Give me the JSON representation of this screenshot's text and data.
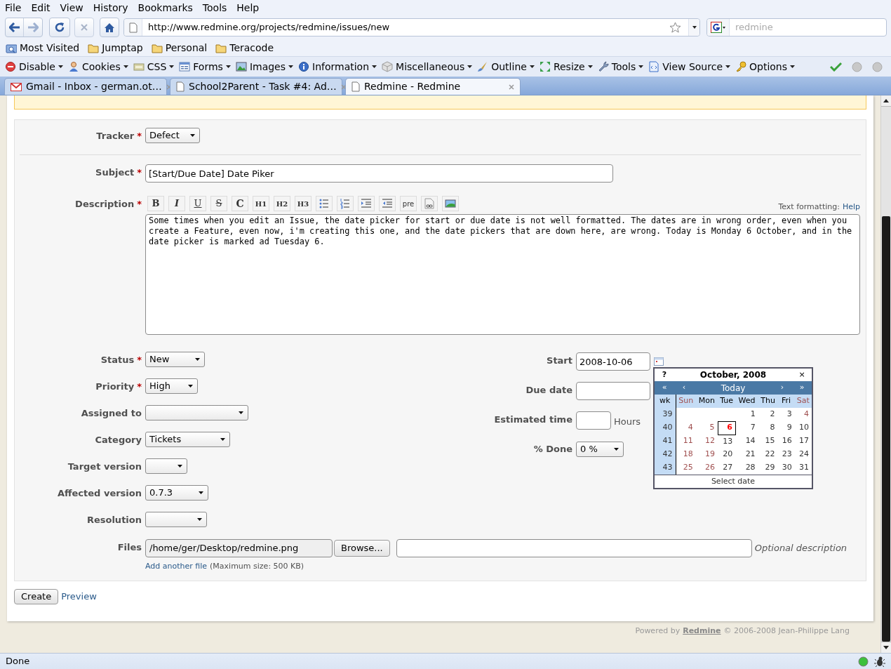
{
  "menu_bar": [
    {
      "label": "File"
    },
    {
      "label": "Edit"
    },
    {
      "label": "View"
    },
    {
      "label": "History"
    },
    {
      "label": "Bookmarks"
    },
    {
      "label": "Tools"
    },
    {
      "label": "Help"
    }
  ],
  "address_bar": {
    "url": "http://www.redmine.org/projects/redmine/issues/new"
  },
  "search_bar": {
    "placeholder": "redmine"
  },
  "bookmarks": [
    {
      "label": "Most Visited",
      "kind": "smart"
    },
    {
      "label": "Jumptap",
      "kind": "folder"
    },
    {
      "label": "Personal",
      "kind": "folder"
    },
    {
      "label": "Teracode",
      "kind": "folder"
    }
  ],
  "developer_toolbar": [
    {
      "label": "Disable"
    },
    {
      "label": "Cookies"
    },
    {
      "label": "CSS"
    },
    {
      "label": "Forms"
    },
    {
      "label": "Images"
    },
    {
      "label": "Information"
    },
    {
      "label": "Miscellaneous"
    },
    {
      "label": "Outline"
    },
    {
      "label": "Resize"
    },
    {
      "label": "Tools"
    },
    {
      "label": "View Source"
    },
    {
      "label": "Options"
    }
  ],
  "tabs": [
    {
      "title": "Gmail - Inbox - german.ot…",
      "kind": "mail",
      "selected": false
    },
    {
      "title": "School2Parent - Task #4: Ad…",
      "kind": "page",
      "selected": false
    },
    {
      "title": "Redmine - Redmine",
      "kind": "page",
      "selected": true
    }
  ],
  "issue_form": {
    "tracker": {
      "label": "Tracker",
      "required_mark": "*",
      "value": "Defect"
    },
    "subject": {
      "label": "Subject",
      "required_mark": "*",
      "value": "[Start/Due Date] Date Piker"
    },
    "description": {
      "label": "Description",
      "required_mark": "*",
      "toolbar": [
        {
          "kind": "bold",
          "label": "B"
        },
        {
          "kind": "italic",
          "label": "I"
        },
        {
          "kind": "underline",
          "label": "U"
        },
        {
          "kind": "strike",
          "label": "S"
        },
        {
          "kind": "code",
          "label": "C"
        },
        {
          "kind": "heading",
          "label": "H1"
        },
        {
          "kind": "heading",
          "label": "H2"
        },
        {
          "kind": "heading",
          "label": "H3"
        },
        {
          "kind": "ul"
        },
        {
          "kind": "ol"
        },
        {
          "kind": "indent"
        },
        {
          "kind": "outdent"
        },
        {
          "kind": "pre",
          "label": "pre"
        },
        {
          "kind": "link"
        },
        {
          "kind": "image"
        }
      ],
      "text_formatting": {
        "label": "Text formatting:",
        "link": "Help"
      },
      "value": "Some times when you edit an Issue, the date picker for start or due date is not well formatted. The dates are in wrong order, even when you create a Feature, even now, i'm creating this one, and the date pickers that are down here, are wrong. Today is Monday 6 October, and in the date picker is marked ad Tuesday 6."
    },
    "attributes_left": [
      {
        "label": "Status",
        "required_mark": "*",
        "value": "New"
      },
      {
        "label": "Priority",
        "required_mark": "*",
        "value": "High"
      },
      {
        "label": "Assigned to"
      },
      {
        "label": "Category",
        "value": "Tickets"
      },
      {
        "label": "Target version"
      },
      {
        "label": "Affected version",
        "value": "0.7.3"
      },
      {
        "label": "Resolution"
      }
    ],
    "attributes_right": [
      {
        "label": "Start",
        "kind": "date",
        "value": "2008-10-06"
      },
      {
        "label": "Due date",
        "kind": "text"
      },
      {
        "label": "Estimated time",
        "kind": "text",
        "unit": "Hours"
      },
      {
        "label": "% Done",
        "kind": "select",
        "value": "0 %"
      }
    ],
    "files": {
      "label": "Files",
      "path": "/home/ger/Desktop/redmine.png",
      "browse": "Browse...",
      "description_hint": "Optional description",
      "add_link": "Add another file",
      "max_size": "(Maximum size: 500 KB)"
    },
    "create": "Create",
    "preview": "Preview"
  },
  "calendar": {
    "help": "?",
    "title": "October, 2008",
    "close": "×",
    "nav": [
      "«",
      "‹",
      "Today",
      "›",
      "»"
    ],
    "week_header": "wk",
    "day_names": [
      {
        "label": "Sun",
        "weekend": true
      },
      {
        "label": "Mon",
        "weekend": false
      },
      {
        "label": "Tue",
        "weekend": false
      },
      {
        "label": "Wed",
        "weekend": false
      },
      {
        "label": "Thu",
        "weekend": false
      },
      {
        "label": "Fri",
        "weekend": false
      },
      {
        "label": "Sat",
        "weekend": true
      }
    ],
    "weeks": [
      {
        "week": "39",
        "days": [
          {
            "label": "1",
            "weekend": false,
            "selected": false
          },
          {
            "label": "2",
            "weekend": false,
            "selected": false
          },
          {
            "label": "3",
            "weekend": false,
            "selected": false
          },
          {
            "label": "4",
            "weekend": true,
            "selected": false
          }
        ]
      },
      {
        "week": "40",
        "days": [
          {
            "label": "4",
            "weekend": true,
            "selected": false
          },
          {
            "label": "5",
            "weekend": true,
            "selected": false
          },
          {
            "label": "6",
            "selected": true
          },
          {
            "label": "7",
            "weekend": false,
            "selected": false
          },
          {
            "label": "8",
            "weekend": false,
            "selected": false
          },
          {
            "label": "9",
            "weekend": false,
            "selected": false
          },
          {
            "label": "10",
            "weekend": false,
            "selected": false
          }
        ]
      },
      {
        "week": "41",
        "days": [
          {
            "label": "11",
            "weekend": true,
            "selected": false
          },
          {
            "label": "12",
            "weekend": true,
            "selected": false
          },
          {
            "label": "13",
            "weekend": false,
            "selected": false
          },
          {
            "label": "14",
            "weekend": false,
            "selected": false
          },
          {
            "label": "15",
            "weekend": false,
            "selected": false
          },
          {
            "label": "16",
            "weekend": false,
            "selected": false
          },
          {
            "label": "17",
            "weekend": false,
            "selected": false
          }
        ]
      },
      {
        "week": "42",
        "days": [
          {
            "label": "18",
            "weekend": true,
            "selected": false
          },
          {
            "label": "19",
            "weekend": true,
            "selected": false
          },
          {
            "label": "20",
            "weekend": false,
            "selected": false
          },
          {
            "label": "21",
            "weekend": false,
            "selected": false
          },
          {
            "label": "22",
            "weekend": false,
            "selected": false
          },
          {
            "label": "23",
            "weekend": false,
            "selected": false
          },
          {
            "label": "24",
            "weekend": false,
            "selected": false
          }
        ]
      },
      {
        "week": "43",
        "days": [
          {
            "label": "25",
            "weekend": true,
            "selected": false
          },
          {
            "label": "26",
            "weekend": true,
            "selected": false
          },
          {
            "label": "27",
            "weekend": false,
            "selected": false
          },
          {
            "label": "28",
            "weekend": false,
            "selected": false
          },
          {
            "label": "29",
            "weekend": false,
            "selected": false
          },
          {
            "label": "30",
            "weekend": false,
            "selected": false
          },
          {
            "label": "31",
            "weekend": false,
            "selected": false
          }
        ]
      }
    ],
    "footer": "Select date"
  },
  "footer": {
    "powered_by": "Powered by",
    "link": "Redmine",
    "copyright": "© 2006-2008 Jean-Philippe Lang"
  },
  "status_bar": {
    "text": "Done"
  }
}
